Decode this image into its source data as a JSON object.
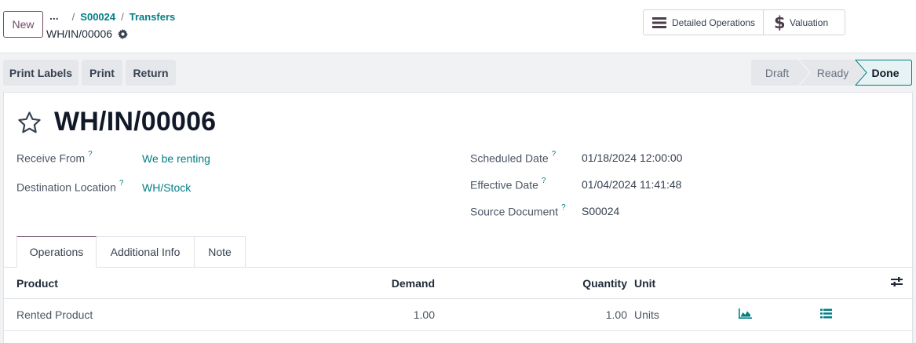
{
  "header": {
    "new_label": "New",
    "breadcrumb_dots": "...",
    "breadcrumb_sep": "/",
    "breadcrumb_items": [
      "S00024",
      "Transfers"
    ],
    "record_name": "WH/IN/00006"
  },
  "smart_buttons": {
    "detailed_operations": "Detailed Operations",
    "valuation": "Valuation"
  },
  "statusbar": {
    "buttons": [
      "Print Labels",
      "Print",
      "Return"
    ],
    "stages": [
      "Draft",
      "Ready",
      "Done"
    ],
    "current_stage": "Done"
  },
  "form": {
    "title": "WH/IN/00006",
    "help_mark": "?",
    "fields_left": [
      {
        "label": "Receive From",
        "value": "We be renting"
      },
      {
        "label": "Destination Location",
        "value": "WH/Stock"
      }
    ],
    "fields_right": [
      {
        "label": "Scheduled Date",
        "value": "01/18/2024 12:00:00"
      },
      {
        "label": "Effective Date",
        "value": "01/04/2024 11:41:48"
      },
      {
        "label": "Source Document",
        "value": "S00024"
      }
    ]
  },
  "tabs": [
    "Operations",
    "Additional Info",
    "Note"
  ],
  "table": {
    "columns": [
      "Product",
      "Demand",
      "Quantity",
      "Unit"
    ],
    "rows": [
      {
        "product": "Rented Product",
        "demand": "1.00",
        "quantity": "1.00",
        "unit": "Units"
      }
    ]
  },
  "colors": {
    "brand": "#714b67",
    "link": "#017e84",
    "stage_active_bg": "#e6f2f3"
  },
  "icons": [
    "gear-icon",
    "list-icon",
    "dollar-icon",
    "star-icon",
    "sliders-icon",
    "area-chart-icon",
    "list-details-icon"
  ]
}
